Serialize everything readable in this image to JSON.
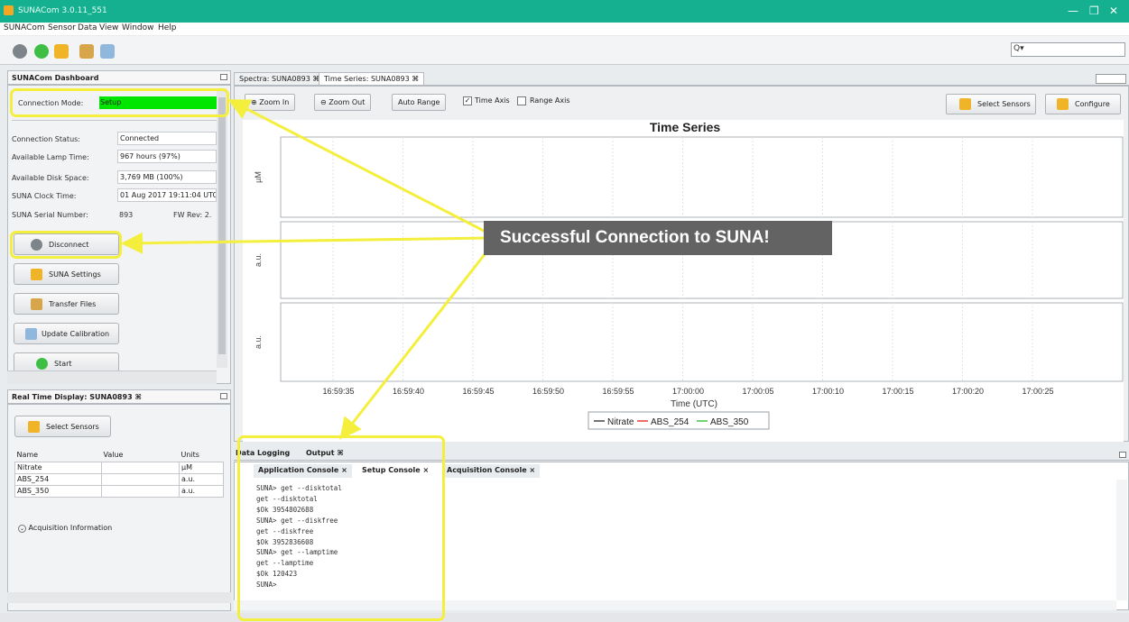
{
  "window": {
    "title": "SUNACom 3.0.11_551"
  },
  "menu": [
    "SUNACom",
    "Sensor",
    "Data",
    "View",
    "Window",
    "Help"
  ],
  "toolbar": {
    "icons": [
      "connect-icon",
      "start-icon",
      "settings-icon",
      "transfer-icon",
      "calibration-icon"
    ],
    "search_glyph": "Q▾"
  },
  "dashboard": {
    "title": "SUNACom Dashboard",
    "connection_mode_label": "Connection Mode:",
    "connection_mode_value": "Setup",
    "rows": [
      {
        "label": "Connection Status:",
        "value": "Connected"
      },
      {
        "label": "Available Lamp Time:",
        "value": "967 hours (97%)"
      },
      {
        "label": "Available Disk Space:",
        "value": "3,769 MB (100%)"
      },
      {
        "label": "SUNA Clock Time:",
        "value": "01 Aug 2017 19:11:04 UTC"
      },
      {
        "label": "SUNA Serial Number:",
        "value": "893",
        "extra": "FW Rev: 2."
      }
    ],
    "buttons": [
      "Disconnect",
      "SUNA Settings",
      "Transfer Files",
      "Update Calibration",
      "Start"
    ]
  },
  "realtime": {
    "title": "Real Time Display: SUNA0893",
    "select_sensors": "Select Sensors",
    "columns": [
      "Name",
      "Value",
      "Units"
    ],
    "rows": [
      {
        "name": "Nitrate",
        "value": "",
        "units": "µM"
      },
      {
        "name": "ABS_254",
        "value": "",
        "units": "a.u."
      },
      {
        "name": "ABS_350",
        "value": "",
        "units": "a.u."
      }
    ],
    "acquisition_info": "Acquisition Information"
  },
  "tabs": [
    "Spectra: SUNA0893",
    "Time Series: SUNA0893"
  ],
  "chart_toolbar": {
    "zoom_in": "Zoom In",
    "zoom_out": "Zoom Out",
    "auto_range": "Auto Range",
    "time_axis": "Time Axis",
    "range_axis": "Range Axis",
    "select_sensors": "Select Sensors",
    "configure": "Configure"
  },
  "chart_data": {
    "type": "line",
    "title": "Time Series",
    "xlabel": "Time (UTC)",
    "x_ticks": [
      "16:59:35",
      "16:59:40",
      "16:59:45",
      "16:59:50",
      "16:59:55",
      "17:00:00",
      "17:00:05",
      "17:00:10",
      "17:00:15",
      "17:00:20",
      "17:00:25"
    ],
    "subplots": [
      {
        "ylabel": "µM"
      },
      {
        "ylabel": "a.u."
      },
      {
        "ylabel": "a.u."
      }
    ],
    "series": [
      {
        "name": "Nitrate",
        "color": "#444444",
        "values": []
      },
      {
        "name": "ABS_254",
        "color": "#e8413b",
        "values": []
      },
      {
        "name": "ABS_350",
        "color": "#42c542",
        "values": []
      }
    ],
    "grid": true,
    "legend": "bottom-center"
  },
  "bottom_tabs": [
    "Data Logging",
    "Output"
  ],
  "console_tabs": [
    "Application Console",
    "Setup Console",
    "Acquisition Console"
  ],
  "console_lines": [
    "SUNA> get --disktotal",
    "get --disktotal",
    "$Ok 3954802688",
    "SUNA> get --diskfree",
    "get --diskfree",
    "$Ok 3952836608",
    "SUNA> get --lamptime",
    "get --lamptime",
    "$Ok 120423",
    "SUNA>"
  ],
  "callout": "Successful Connection to SUNA!",
  "colors": {
    "titlebar": "#14b08f",
    "highlight": "#f4ef3c",
    "mode_green": "#00e600"
  }
}
